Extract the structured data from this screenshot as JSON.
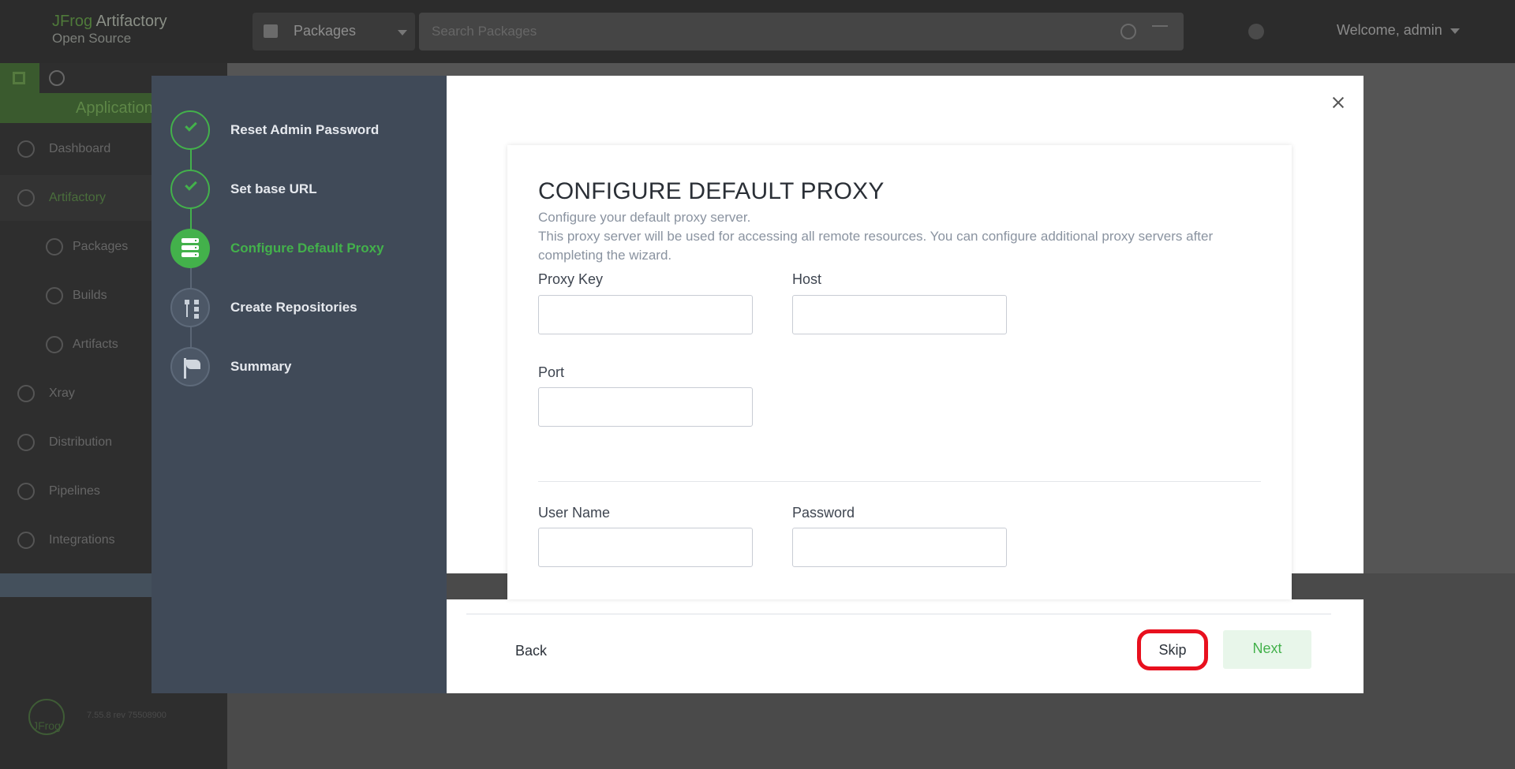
{
  "header": {
    "brand": "JFrog",
    "product": "Artifactory",
    "edition": "Open Source",
    "package_selector": "Packages",
    "search_placeholder": "Search Packages",
    "welcome": "Welcome, admin"
  },
  "sidebar": {
    "app_title": "Application",
    "items": [
      {
        "label": "Dashboard"
      },
      {
        "label": "Artifactory"
      },
      {
        "label": "Packages"
      },
      {
        "label": "Builds"
      },
      {
        "label": "Artifacts"
      },
      {
        "label": "Xray"
      },
      {
        "label": "Distribution"
      },
      {
        "label": "Pipelines"
      },
      {
        "label": "Integrations"
      }
    ],
    "footer_logo": "JFrog",
    "version": "7.55.8 rev 75508900"
  },
  "wizard": {
    "steps": [
      {
        "label": "Reset Admin Password",
        "state": "done"
      },
      {
        "label": "Set base URL",
        "state": "done"
      },
      {
        "label": "Configure Default Proxy",
        "state": "current"
      },
      {
        "label": "Create Repositories",
        "state": "pending"
      },
      {
        "label": "Summary",
        "state": "pending"
      }
    ],
    "title": "CONFIGURE DEFAULT PROXY",
    "desc_line1": "Configure your default proxy server.",
    "desc_line2": "This proxy server will be used for accessing all remote resources. You can configure additional proxy servers after completing the wizard.",
    "fields": {
      "proxy_key": {
        "label": "Proxy Key",
        "value": ""
      },
      "host": {
        "label": "Host",
        "value": ""
      },
      "port": {
        "label": "Port",
        "value": ""
      },
      "user_name": {
        "label": "User Name",
        "value": ""
      },
      "password": {
        "label": "Password",
        "value": ""
      }
    },
    "buttons": {
      "back": "Back",
      "skip": "Skip",
      "next": "Next"
    }
  },
  "colors": {
    "accent_green": "#43b14b",
    "highlight_red": "#e8101e",
    "wizard_sidebar": "#404a58"
  }
}
